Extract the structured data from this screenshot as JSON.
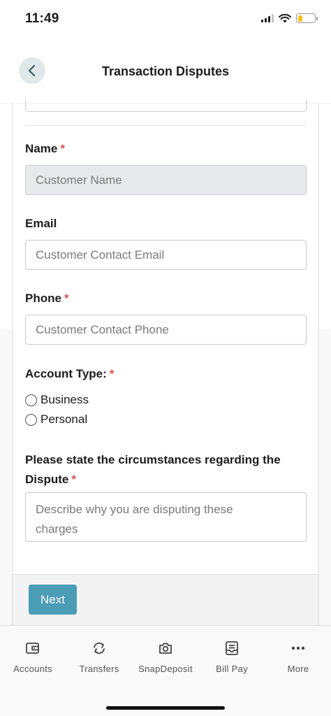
{
  "status_bar": {
    "time": "11:49",
    "battery_level": 0.3
  },
  "header": {
    "title": "Transaction Disputes"
  },
  "form": {
    "name": {
      "label": "Name",
      "required_mark": "*",
      "placeholder": "Customer Name"
    },
    "email": {
      "label": "Email",
      "placeholder": "Customer Contact Email"
    },
    "phone": {
      "label": "Phone",
      "required_mark": "*",
      "placeholder": "Customer Contact Phone"
    },
    "account_type": {
      "label": "Account Type:",
      "required_mark": "*",
      "options": [
        {
          "label": "Business",
          "selected": false
        },
        {
          "label": "Personal",
          "selected": false
        }
      ]
    },
    "circumstances": {
      "label_line1": "Please state the circumstances regarding the",
      "label_line2": "Dispute",
      "required_mark": "*",
      "placeholder_line1": "Describe why you are disputing these",
      "placeholder_line2": "charges"
    },
    "next_label": "Next"
  },
  "tab_bar": {
    "items": [
      {
        "label": "Accounts",
        "icon": "wallet-icon"
      },
      {
        "label": "Transfers",
        "icon": "transfer-arrows-icon"
      },
      {
        "label": "SnapDeposit",
        "icon": "camera-icon"
      },
      {
        "label": "Bill Pay",
        "icon": "bill-tray-icon"
      },
      {
        "label": "More",
        "icon": "more-dots-icon"
      }
    ]
  }
}
